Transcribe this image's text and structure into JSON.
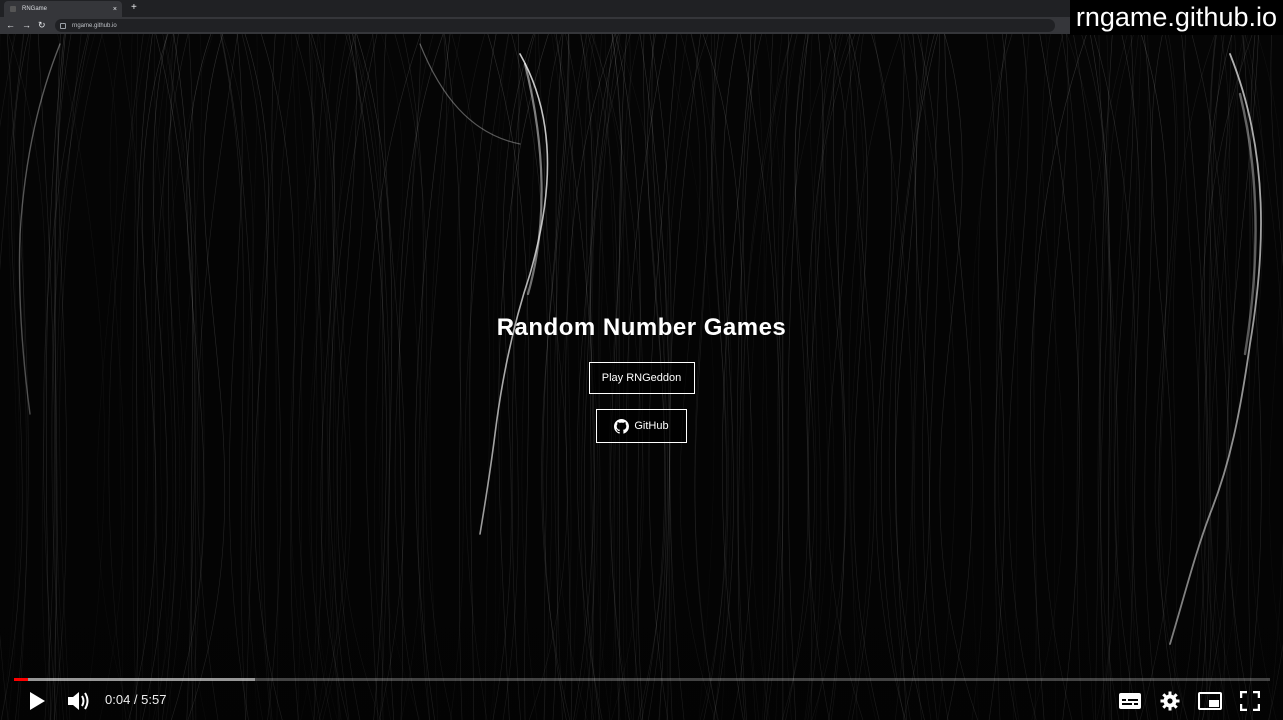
{
  "browser": {
    "tab_title": "RNGame",
    "close_symbol": "×",
    "new_tab_symbol": "+",
    "url": "rngame.github.io"
  },
  "watermark": "rngame.github.io",
  "page": {
    "heading": "Random Number Games",
    "play_button": "Play RNGeddon",
    "github_button": "GitHub"
  },
  "player": {
    "current_time": "0:04",
    "duration": "5:57",
    "time_display": "0:04 / 5:57",
    "played_fraction": 0.011,
    "buffered_fraction": 0.192,
    "accent_color": "#ff0000"
  },
  "icons": {
    "back": "back-arrow-icon",
    "forward": "forward-arrow-icon",
    "reload": "reload-icon",
    "lock": "lock-icon",
    "github": "github-icon",
    "play": "play-icon",
    "volume": "volume-icon",
    "subtitles": "subtitles-icon",
    "settings": "gear-icon",
    "miniplayer": "miniplayer-icon",
    "fullscreen": "fullscreen-icon"
  }
}
